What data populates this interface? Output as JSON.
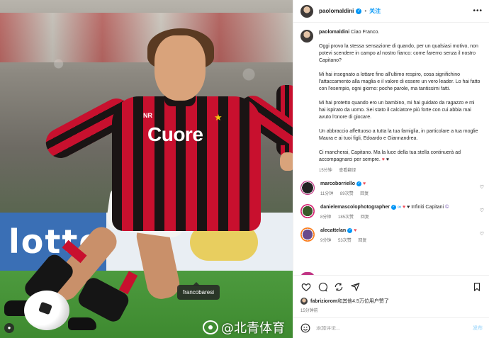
{
  "photo": {
    "board_text": "lotto",
    "shirt_text": "Cuore",
    "shirt_crest": "NR",
    "tag_label": "francobaresi",
    "watermark": "@北青体育"
  },
  "header": {
    "username": "paolomaldini",
    "follow_label": "关注",
    "more_label": "•••"
  },
  "caption": {
    "username": "paolomaldini",
    "paragraphs": [
      "Ciao Franco.",
      "Oggi provo la stessa sensazione di quando, per un qualsiasi motivo, non potevi scendere in campo al nostro fianco: come faremo senza il nostro Capitano?",
      "Mi hai insegnato a lottare fino all'ultimo respiro, cosa significhino l'attaccamento alla maglia e il valore di essere un vero leader. Lo hai fatto con l'esempio, ogni giorno: poche parole, ma tantissimi fatti.",
      "Mi hai protetto quando ero un bambino, mi hai guidato da ragazzo e mi hai ispirato da uomo. Sei stato il calciatore più forte con cui abbia mai avuto l'onore di giocare.",
      "Un abbraccio affettuoso a tutta la tua famiglia, in particolare a tua moglie Maura e ai tuoi figli, Edoardo e Giannandrea.",
      "Ci mancherai, Capitano. Ma la luce della tua stella continuerà ad accompagnarci per sempre."
    ],
    "time": "15分钟",
    "translate_label": "查看翻译"
  },
  "comments": [
    {
      "username": "marcoborriello",
      "text": "",
      "time": "11分钟",
      "likes": "89次赞",
      "reply": "回复"
    },
    {
      "username": "danielemascolophotographer",
      "text": "Infiniti Capitani",
      "time": "8分钟",
      "likes": "185次赞",
      "reply": "回复"
    },
    {
      "username": "alecattelan",
      "text": "",
      "time": "9分钟",
      "likes": "53次赞",
      "reply": "回复"
    }
  ],
  "likes_line": {
    "user": "fabriziorom",
    "rest": "和其他4.5万位用户赞了"
  },
  "post_time": "15分钟前",
  "composer": {
    "placeholder": "添加评论...",
    "post_label": "发布"
  },
  "icons": {
    "actions": [
      "heart-icon",
      "comment-icon",
      "share-icon",
      "send-icon",
      "bookmark-icon"
    ],
    "composer": "emoji-icon"
  },
  "colors": {
    "accent": "#0095f6",
    "heart": "#ed4956",
    "muted": "#737373",
    "text": "#262626"
  }
}
